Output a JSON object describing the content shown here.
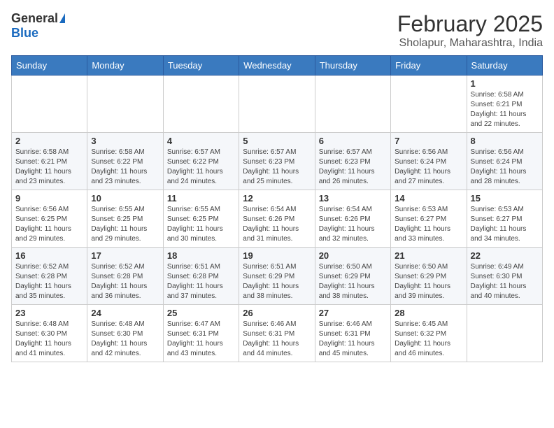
{
  "header": {
    "logo_general": "General",
    "logo_blue": "Blue",
    "month_year": "February 2025",
    "location": "Sholapur, Maharashtra, India"
  },
  "days_of_week": [
    "Sunday",
    "Monday",
    "Tuesday",
    "Wednesday",
    "Thursday",
    "Friday",
    "Saturday"
  ],
  "weeks": [
    [
      {
        "day": "",
        "info": ""
      },
      {
        "day": "",
        "info": ""
      },
      {
        "day": "",
        "info": ""
      },
      {
        "day": "",
        "info": ""
      },
      {
        "day": "",
        "info": ""
      },
      {
        "day": "",
        "info": ""
      },
      {
        "day": "1",
        "info": "Sunrise: 6:58 AM\nSunset: 6:21 PM\nDaylight: 11 hours\nand 22 minutes."
      }
    ],
    [
      {
        "day": "2",
        "info": "Sunrise: 6:58 AM\nSunset: 6:21 PM\nDaylight: 11 hours\nand 23 minutes."
      },
      {
        "day": "3",
        "info": "Sunrise: 6:58 AM\nSunset: 6:22 PM\nDaylight: 11 hours\nand 23 minutes."
      },
      {
        "day": "4",
        "info": "Sunrise: 6:57 AM\nSunset: 6:22 PM\nDaylight: 11 hours\nand 24 minutes."
      },
      {
        "day": "5",
        "info": "Sunrise: 6:57 AM\nSunset: 6:23 PM\nDaylight: 11 hours\nand 25 minutes."
      },
      {
        "day": "6",
        "info": "Sunrise: 6:57 AM\nSunset: 6:23 PM\nDaylight: 11 hours\nand 26 minutes."
      },
      {
        "day": "7",
        "info": "Sunrise: 6:56 AM\nSunset: 6:24 PM\nDaylight: 11 hours\nand 27 minutes."
      },
      {
        "day": "8",
        "info": "Sunrise: 6:56 AM\nSunset: 6:24 PM\nDaylight: 11 hours\nand 28 minutes."
      }
    ],
    [
      {
        "day": "9",
        "info": "Sunrise: 6:56 AM\nSunset: 6:25 PM\nDaylight: 11 hours\nand 29 minutes."
      },
      {
        "day": "10",
        "info": "Sunrise: 6:55 AM\nSunset: 6:25 PM\nDaylight: 11 hours\nand 29 minutes."
      },
      {
        "day": "11",
        "info": "Sunrise: 6:55 AM\nSunset: 6:25 PM\nDaylight: 11 hours\nand 30 minutes."
      },
      {
        "day": "12",
        "info": "Sunrise: 6:54 AM\nSunset: 6:26 PM\nDaylight: 11 hours\nand 31 minutes."
      },
      {
        "day": "13",
        "info": "Sunrise: 6:54 AM\nSunset: 6:26 PM\nDaylight: 11 hours\nand 32 minutes."
      },
      {
        "day": "14",
        "info": "Sunrise: 6:53 AM\nSunset: 6:27 PM\nDaylight: 11 hours\nand 33 minutes."
      },
      {
        "day": "15",
        "info": "Sunrise: 6:53 AM\nSunset: 6:27 PM\nDaylight: 11 hours\nand 34 minutes."
      }
    ],
    [
      {
        "day": "16",
        "info": "Sunrise: 6:52 AM\nSunset: 6:28 PM\nDaylight: 11 hours\nand 35 minutes."
      },
      {
        "day": "17",
        "info": "Sunrise: 6:52 AM\nSunset: 6:28 PM\nDaylight: 11 hours\nand 36 minutes."
      },
      {
        "day": "18",
        "info": "Sunrise: 6:51 AM\nSunset: 6:28 PM\nDaylight: 11 hours\nand 37 minutes."
      },
      {
        "day": "19",
        "info": "Sunrise: 6:51 AM\nSunset: 6:29 PM\nDaylight: 11 hours\nand 38 minutes."
      },
      {
        "day": "20",
        "info": "Sunrise: 6:50 AM\nSunset: 6:29 PM\nDaylight: 11 hours\nand 38 minutes."
      },
      {
        "day": "21",
        "info": "Sunrise: 6:50 AM\nSunset: 6:29 PM\nDaylight: 11 hours\nand 39 minutes."
      },
      {
        "day": "22",
        "info": "Sunrise: 6:49 AM\nSunset: 6:30 PM\nDaylight: 11 hours\nand 40 minutes."
      }
    ],
    [
      {
        "day": "23",
        "info": "Sunrise: 6:48 AM\nSunset: 6:30 PM\nDaylight: 11 hours\nand 41 minutes."
      },
      {
        "day": "24",
        "info": "Sunrise: 6:48 AM\nSunset: 6:30 PM\nDaylight: 11 hours\nand 42 minutes."
      },
      {
        "day": "25",
        "info": "Sunrise: 6:47 AM\nSunset: 6:31 PM\nDaylight: 11 hours\nand 43 minutes."
      },
      {
        "day": "26",
        "info": "Sunrise: 6:46 AM\nSunset: 6:31 PM\nDaylight: 11 hours\nand 44 minutes."
      },
      {
        "day": "27",
        "info": "Sunrise: 6:46 AM\nSunset: 6:31 PM\nDaylight: 11 hours\nand 45 minutes."
      },
      {
        "day": "28",
        "info": "Sunrise: 6:45 AM\nSunset: 6:32 PM\nDaylight: 11 hours\nand 46 minutes."
      },
      {
        "day": "",
        "info": ""
      }
    ]
  ]
}
